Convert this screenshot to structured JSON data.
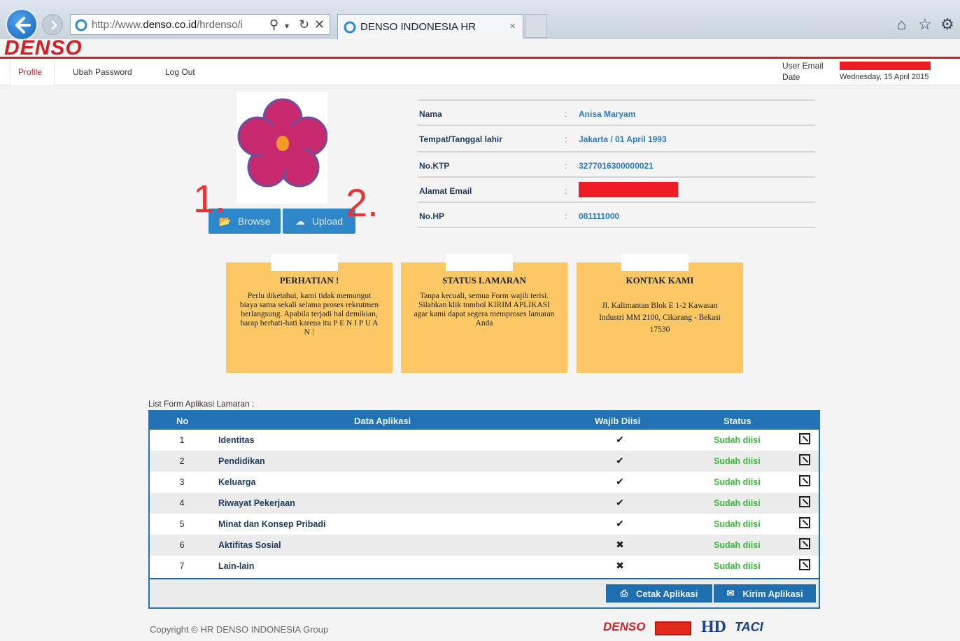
{
  "browser": {
    "url_prefix": "http://www.",
    "url_domain": "denso.co.id",
    "url_suffix": "/hrdenso/i",
    "tab_title": "DENSO INDONESIA HR",
    "tab_close": "×"
  },
  "site": {
    "logo": "DENSO"
  },
  "nav": {
    "items": [
      "Profile",
      "Ubah Password",
      "Log Out"
    ]
  },
  "user_info": {
    "email_label": "User Email",
    "date_label": "Date",
    "date_value": "Wednesday, 15 April 2015"
  },
  "photo": {
    "browse_label": "Browse",
    "upload_label": "Upload",
    "annotation_1": "1.",
    "annotation_2": "2."
  },
  "profile": {
    "rows": [
      {
        "label": "Nama",
        "sep": ":",
        "value": "Anisa Maryam"
      },
      {
        "label": "Tempat/Tanggal lahir",
        "sep": ":",
        "value": "Jakarta / 01 April 1993"
      },
      {
        "label": "No.KTP",
        "sep": ":",
        "value": "3277016300000021"
      },
      {
        "label": "Alamat Email",
        "sep": ":",
        "value": ""
      },
      {
        "label": "No.HP",
        "sep": ":",
        "value": "081111000"
      }
    ]
  },
  "notices": [
    {
      "title": "PERHATIAN !",
      "body": "Perlu diketahui, kami tidak memungut biaya sama sekali selama proses rekrutmen berlangsung. Apabila terjadi hal demikian, harap berhati-hati karena itu P E N I P U A N !"
    },
    {
      "title": "STATUS LAMARAN",
      "body": "Tanpa kecuali, semua Form wajib terisi. Silahkan klik tombol KIRIM APLIKASI agar kami dapat segera memproses lamaran Anda"
    },
    {
      "title": "KONTAK KAMI",
      "body": "Jl. Kalimantan Blok E 1-2 Kawasan Industri MM 2100, Cikarang - Bekasi 17530"
    }
  ],
  "applications": {
    "section_label": "List Form Aplikasi Lamaran :",
    "headers": {
      "no": "No",
      "data": "Data Aplikasi",
      "wajib": "Wajib Diisi",
      "status": "Status"
    },
    "rows": [
      {
        "no": "1",
        "name": "Identitas",
        "wajib": "✔",
        "status": "Sudah diisi"
      },
      {
        "no": "2",
        "name": "Pendidikan",
        "wajib": "✔",
        "status": "Sudah diisi"
      },
      {
        "no": "3",
        "name": "Keluarga",
        "wajib": "✔",
        "status": "Sudah diisi"
      },
      {
        "no": "4",
        "name": "Riwayat Pekerjaan",
        "wajib": "✔",
        "status": "Sudah diisi"
      },
      {
        "no": "5",
        "name": "Minat dan Konsep Pribadi",
        "wajib": "✔",
        "status": "Sudah diisi"
      },
      {
        "no": "6",
        "name": "Aktifitas Sosial",
        "wajib": "✖",
        "status": "Sudah diisi"
      },
      {
        "no": "7",
        "name": "Lain-lain",
        "wajib": "✖",
        "status": "Sudah diisi"
      }
    ],
    "print_label": "Cetak Aplikasi",
    "send_label": "Kirim Aplikasi"
  },
  "footer": {
    "copyright": "Copyright © HR DENSO INDONESIA Group",
    "logos": [
      "DENSO",
      "HD",
      "TACI"
    ]
  },
  "colors": {
    "brand_red": "#d31e25",
    "primary_blue": "#2372b4",
    "notice_yellow": "#fbc865",
    "status_green": "#3eb43e"
  }
}
